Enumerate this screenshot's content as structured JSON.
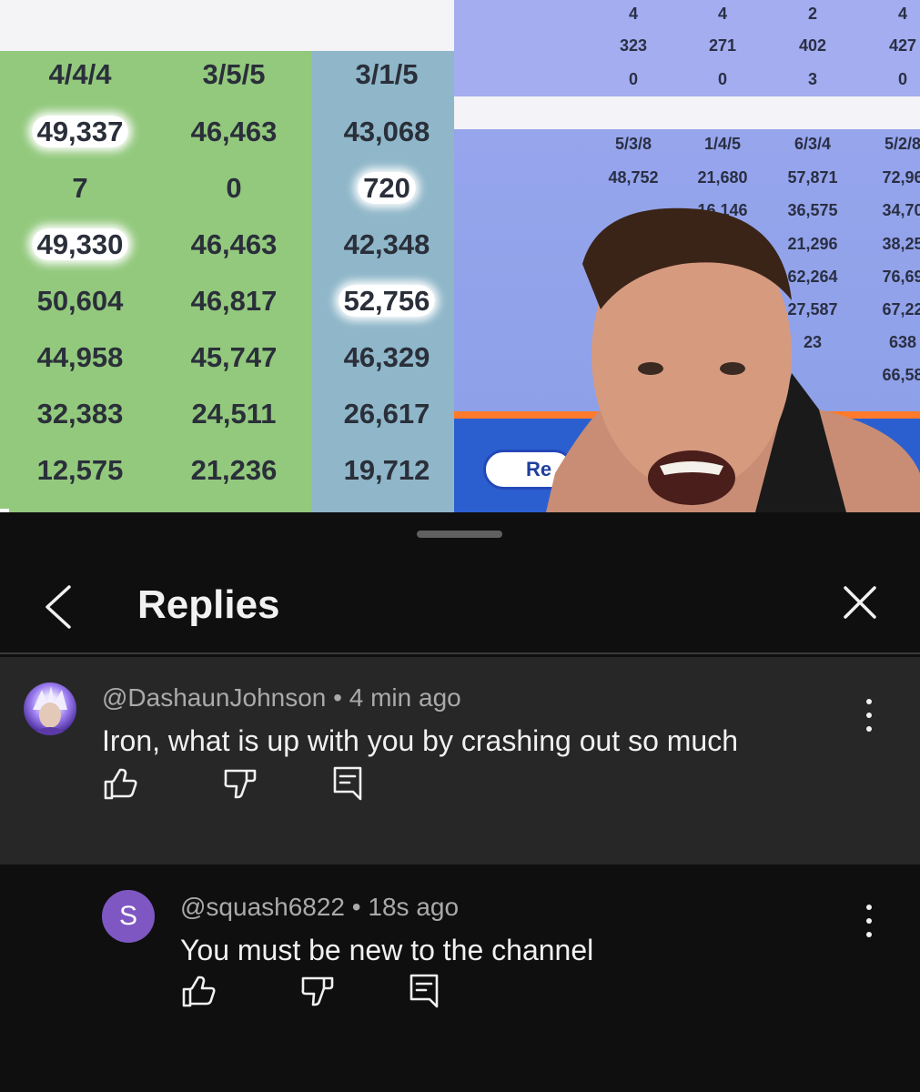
{
  "video": {
    "left_table": {
      "headers": [
        "4/4/4",
        "3/5/5",
        "3/1/5"
      ],
      "rows": [
        [
          "49,337",
          "46,463",
          "43,068"
        ],
        [
          "7",
          "0",
          "720"
        ],
        [
          "49,330",
          "46,463",
          "42,348"
        ],
        [
          "50,604",
          "46,817",
          "52,756"
        ],
        [
          "44,958",
          "45,747",
          "46,329"
        ],
        [
          "32,383",
          "24,511",
          "26,617"
        ],
        [
          "12,575",
          "21,236",
          "19,712"
        ]
      ]
    },
    "right_table": {
      "top_rows": [
        [
          "4",
          "4",
          "2",
          "4"
        ],
        [
          "323",
          "271",
          "402",
          "427"
        ],
        [
          "0",
          "0",
          "3",
          "0"
        ]
      ],
      "headers": [
        "5/3/8",
        "1/4/5",
        "6/3/4",
        "5/2/8"
      ],
      "rows": [
        [
          "48,752",
          "21,680",
          "57,871",
          "72,96"
        ],
        [
          "",
          "16,146",
          "36,575",
          "34,70"
        ],
        [
          "",
          "",
          "21,296",
          "38,25"
        ],
        [
          "",
          "",
          "62,264",
          "76,69"
        ],
        [
          "",
          "",
          "27,587",
          "67,22"
        ],
        [
          "",
          "",
          "23",
          "638"
        ],
        [
          "",
          "",
          "",
          "66,58"
        ]
      ]
    },
    "button_label": "Re"
  },
  "sheet": {
    "title": "Replies",
    "comments": [
      {
        "author": "@DashaunJohnson",
        "time": "4 min ago",
        "text": "Iron, what is up with you by crashing out so much"
      },
      {
        "avatar_letter": "S",
        "author": "@squash6822",
        "time": "18s ago",
        "text": "You must be new to the channel"
      }
    ]
  },
  "colors": {
    "sheet_bg": "#0f0f0f",
    "parent_bg": "#272727",
    "reply_avatar": "#7e57c2"
  },
  "icons": [
    "back-arrow-icon",
    "close-icon",
    "more-vert-icon",
    "thumb-up-icon",
    "thumb-down-icon",
    "reply-icon"
  ]
}
